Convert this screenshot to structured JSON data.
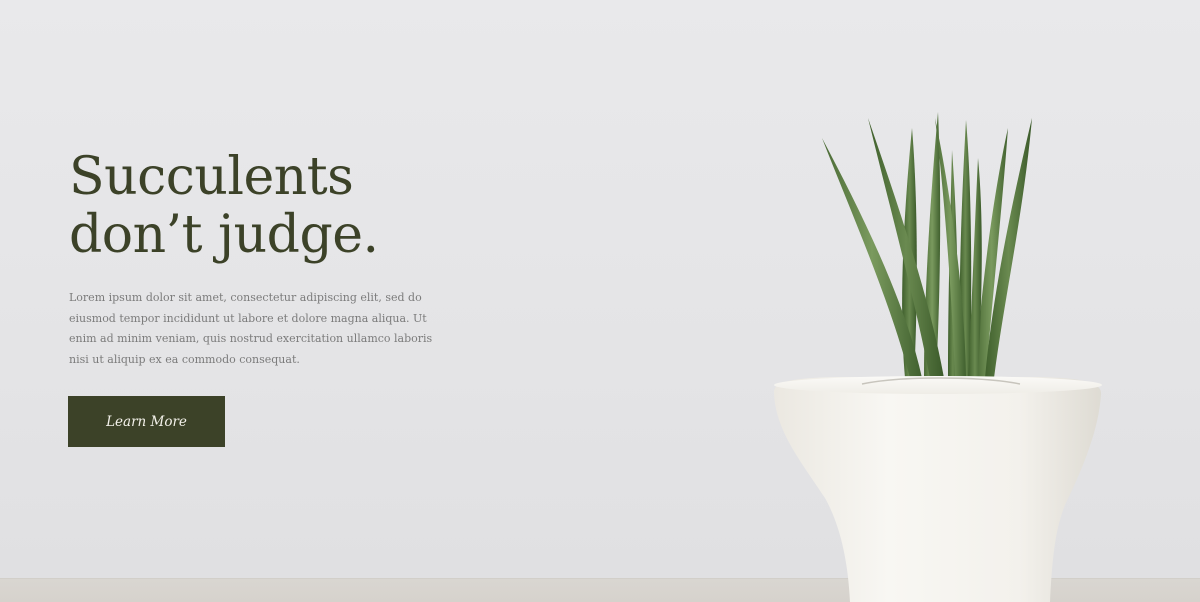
{
  "hero": {
    "headline_line1": "Succulents",
    "headline_line2": "don’t judge.",
    "body": "Lorem ipsum dolor sit amet, consectetur adipiscing elit, sed do eiusmod tempor incididunt ut labore et dolore magna aliqua. Ut enim ad minim veniam, quis nostrud exercitation ullamco laboris nisi ut aliquip ex ea commodo consequat.",
    "cta_label": "Learn More"
  },
  "colors": {
    "accent": "#3c4228",
    "body_text": "#7b7b7b",
    "background": "#e6e6e8",
    "pot": "#f4f2ec",
    "leaf": "#4f6f3a"
  },
  "image": {
    "subject": "snake-plant-in-white-pot"
  }
}
